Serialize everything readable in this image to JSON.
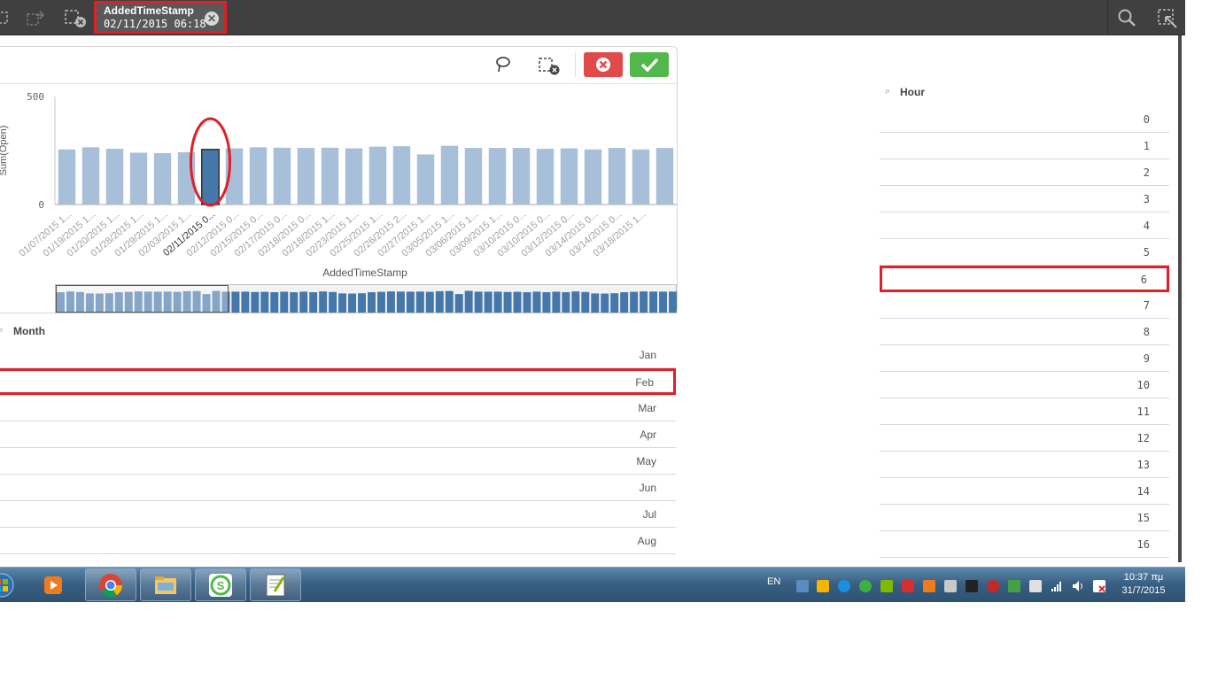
{
  "toolbar": {
    "selection_field": "AddedTimeStamp",
    "selection_value": "02/11/2015 06:18",
    "icons": [
      "selections-back-icon",
      "selections-forward-icon",
      "clear-selections-icon",
      "search-icon",
      "smart-search-icon"
    ]
  },
  "chart_toolbar": {
    "icons": [
      "lasso-icon",
      "clear-selection-icon",
      "cancel-icon",
      "confirm-icon"
    ]
  },
  "chart_data": {
    "type": "bar",
    "xlabel": "AddedTimeStamp",
    "ylabel": "Sum(Open)",
    "ylim": [
      0,
      500
    ],
    "yticks": [
      "500",
      "0"
    ],
    "selected_index": 6,
    "categories": [
      "01/07/2015 1...",
      "01/19/2015 1...",
      "01/20/2015 1...",
      "01/28/2015 1...",
      "01/29/2015 1...",
      "02/03/2015 1...",
      "02/11/2015 0...",
      "02/12/2015 0...",
      "02/15/2015 0...",
      "02/17/2015 0...",
      "02/18/2015 0...",
      "02/18/2015 1...",
      "02/23/2015 1...",
      "02/25/2015 1...",
      "02/26/2015 2...",
      "02/27/2015 1...",
      "03/05/2015 1...",
      "03/06/2015 1...",
      "03/09/2015 1...",
      "03/10/2015 0...",
      "03/10/2015 0...",
      "03/12/2015 0...",
      "03/14/2015 0...",
      "03/14/2015 0...",
      "03/18/2015 1..."
    ],
    "values": [
      255,
      265,
      258,
      240,
      238,
      242,
      255,
      260,
      265,
      263,
      262,
      263,
      260,
      268,
      270,
      232,
      272,
      262,
      262,
      262,
      258,
      260,
      255,
      262,
      255,
      262
    ],
    "colors": {
      "bar": "#a8bfd9",
      "selected": "#4477aa",
      "selected_stroke": "#333333"
    }
  },
  "month_list": {
    "title": "Month",
    "items": [
      "Jan",
      "Feb",
      "Mar",
      "Apr",
      "May",
      "Jun",
      "Jul",
      "Aug"
    ],
    "marked": "Feb"
  },
  "hour_list": {
    "title": "Hour",
    "items": [
      "0",
      "1",
      "2",
      "3",
      "4",
      "5",
      "6",
      "7",
      "8",
      "9",
      "10",
      "11",
      "12",
      "13",
      "14",
      "15",
      "16"
    ],
    "marked": "6"
  },
  "taskbar": {
    "apps": [
      "start-icon",
      "media-player-icon",
      "chrome-icon",
      "explorer-icon",
      "qlik-sense-icon",
      "notepad-plus-plus-icon"
    ],
    "language": "EN",
    "time": "10:37 πμ",
    "date": "31/7/2015"
  },
  "annotation_color": "#e01f26"
}
